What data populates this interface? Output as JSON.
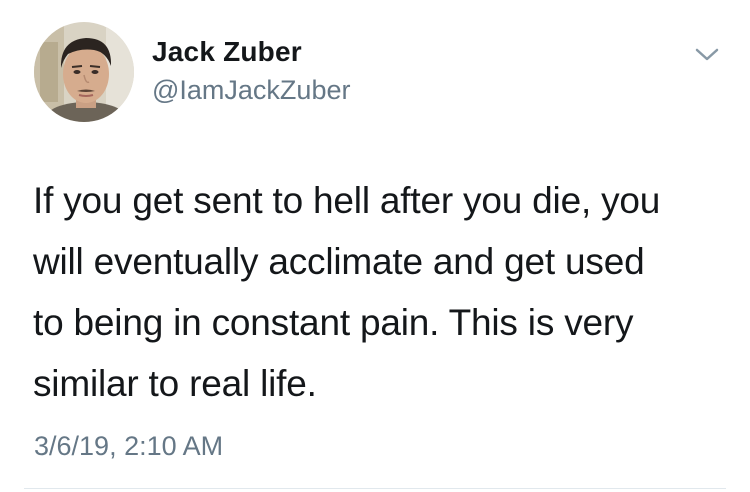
{
  "author": {
    "name": "Jack Zuber",
    "handle": "@IamJackZuber"
  },
  "tweet": {
    "lines": [
      "If you get sent to hell after you die, you",
      "will eventually acclimate and get used",
      "to being in constant pain. This is very",
      "similar to real life."
    ],
    "timestamp": "3/6/19, 2:10 AM"
  },
  "icons": {
    "menu": "chevron-down-icon"
  },
  "colors": {
    "text": "#14171a",
    "secondary": "#657786",
    "divider": "#e1e8ed"
  }
}
